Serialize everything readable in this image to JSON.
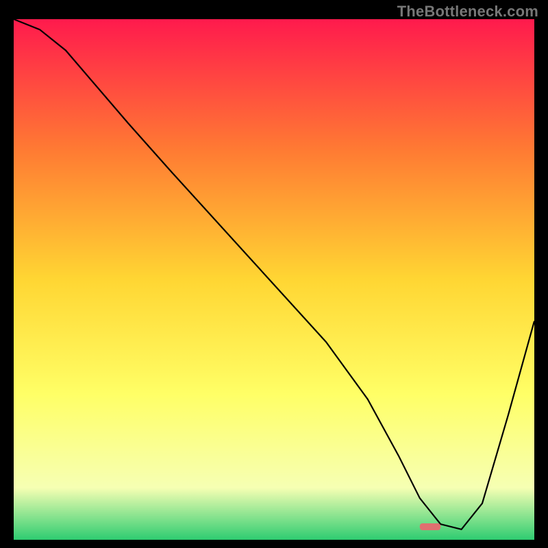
{
  "watermark": "TheBottleneck.com",
  "chart_data": {
    "type": "line",
    "title": "",
    "xlabel": "",
    "ylabel": "",
    "xlim": [
      0,
      100
    ],
    "ylim": [
      0,
      100
    ],
    "grid": false,
    "series": [
      {
        "name": "curve",
        "x": [
          0,
          5,
          10,
          22,
          30,
          40,
          50,
          60,
          68,
          74,
          78,
          82,
          86,
          90,
          95,
          100
        ],
        "values": [
          100,
          98,
          94,
          80,
          71,
          60,
          49,
          38,
          27,
          16,
          8,
          3,
          2,
          7,
          24,
          42
        ]
      },
      {
        "name": "marker",
        "x": [
          78,
          82
        ],
        "values": [
          2.5,
          2.5
        ]
      }
    ],
    "colors": {
      "curve": "#000000",
      "marker": "#e07070",
      "gradient_top": "#ff1a4d",
      "gradient_mid_upper": "#ff7a33",
      "gradient_mid": "#ffd633",
      "gradient_mid_lower": "#ffff66",
      "gradient_lower": "#f6ffb3",
      "gradient_bottom": "#2ecc71"
    }
  }
}
